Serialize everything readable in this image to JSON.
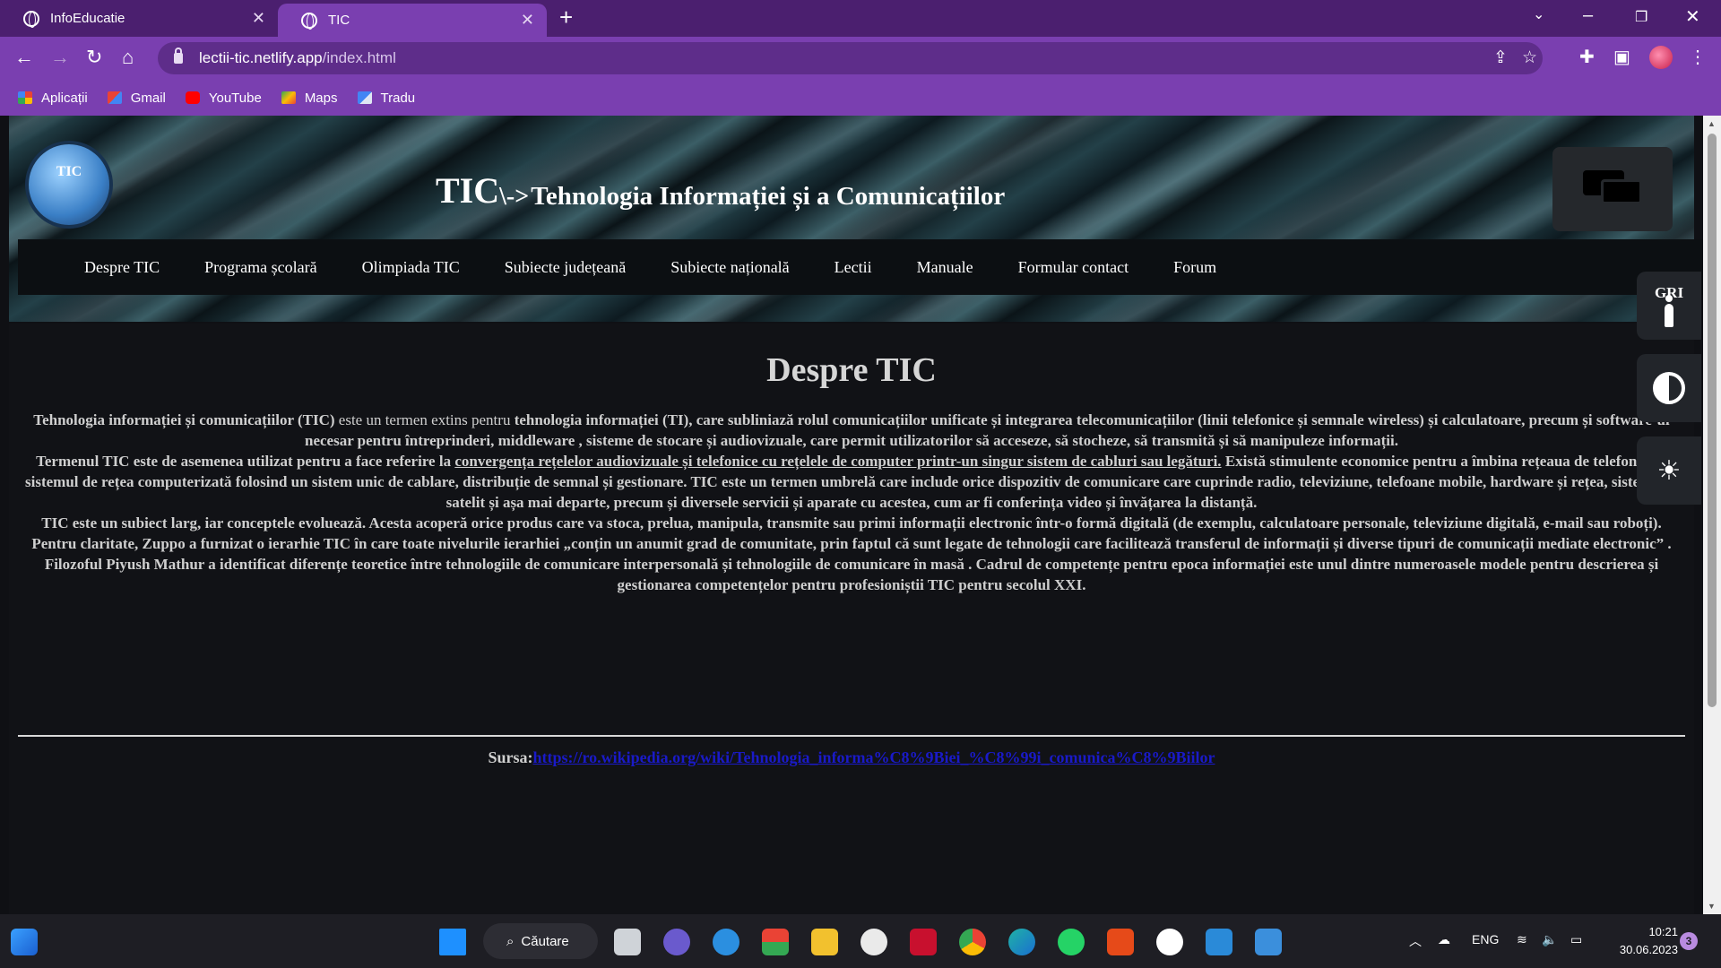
{
  "browser": {
    "tabs": [
      {
        "title": "InfoEducatie"
      },
      {
        "title": "TIC"
      }
    ],
    "url_host": "lectii-tic.netlify.app",
    "url_path": "/index.html",
    "bookmarks": [
      {
        "label": "Aplicații",
        "icon": "apps-grid-icon"
      },
      {
        "label": "Gmail",
        "icon": "gmail-icon"
      },
      {
        "label": "YouTube",
        "icon": "youtube-icon"
      },
      {
        "label": "Maps",
        "icon": "maps-icon"
      },
      {
        "label": "Tradu",
        "icon": "translate-icon"
      }
    ],
    "colors": {
      "frame": "#4b1f6f",
      "toolbar": "#7a3fb0"
    }
  },
  "site": {
    "logo_text": "TIC",
    "title_main": "TIC",
    "title_arrow": "\\->",
    "title_sub": "Tehnologia Informației și a Comunicațiilor",
    "nav": [
      "Despre TIC",
      "Programa școlară",
      "Olimpiada TIC",
      "Subiecte județeană",
      "Subiecte națională",
      "Lectii",
      "Manuale",
      "Formular contact",
      "Forum"
    ],
    "accessibility": {
      "gri_label": "GRI"
    }
  },
  "article": {
    "heading": "Despre TIC",
    "p1_a": "Tehnologia informației și comunicațiilor (TIC)",
    "p1_b": " este un termen extins pentru ",
    "p1_c": "tehnologia informației (TI), care subliniază rolul comunicațiilor unificate și integrarea telecomunicațiilor (linii telefonice și semnale wireless) și calculatoare, precum și software-ul necesar pentru întreprinderi, middleware , sisteme de stocare și audiovizuale, care permit utilizatorilor să acceseze, să stocheze, să transmită și să manipuleze informații.",
    "p2_a": "Termenul TIC este de asemenea utilizat pentru a face referire la ",
    "p2_link": "convergența rețelelor audiovizuale și telefonice cu rețelele de computer printr-un singur sistem de cabluri sau legături.",
    "p2_b": " Există stimulente economice pentru a îmbina rețeaua de telefonie cu sistemul de rețea computerizată folosind un sistem unic de cablare, distribuție de semnal și gestionare. TIC este un termen umbrelă care include orice dispozitiv de comunicare care cuprinde radio, televiziune, telefoane mobile, hardware și rețea, sisteme de satelit și așa mai departe, precum și diversele servicii și aparate cu acestea, cum ar fi conferința video și învățarea la distanță.",
    "p3": "TIC este un subiect larg, iar conceptele evoluează. Acesta acoperă orice produs care va stoca, prelua, manipula, transmite sau primi informații electronic într-o formă digitală (de exemplu, calculatoare personale, televiziune digitală, e-mail sau roboți). Pentru claritate, Zuppo a furnizat o ierarhie TIC în care toate nivelurile ierarhiei „conțin un anumit grad de comunitate, prin faptul că sunt legate de tehnologii care facilitează transferul de informații și diverse tipuri de comunicații mediate electronic” . Filozoful Piyush Mathur a identificat diferențe teoretice între tehnologiile de comunicare interpersonală și tehnologiile de comunicare în masă . Cadrul de competențe pentru epoca informației este unul dintre numeroasele modele pentru descrierea și gestionarea competențelor pentru profesioniștii TIC pentru secolul XXI.",
    "source_label": "Sursa:",
    "source_url": "https://ro.wikipedia.org/wiki/Tehnologia_informa%C8%9Biei_%C8%99i_comunica%C8%9Biilor"
  },
  "taskbar": {
    "search_label": "Căutare",
    "language": "ENG",
    "time": "10:21",
    "date": "30.06.2023",
    "notifications": "3"
  }
}
